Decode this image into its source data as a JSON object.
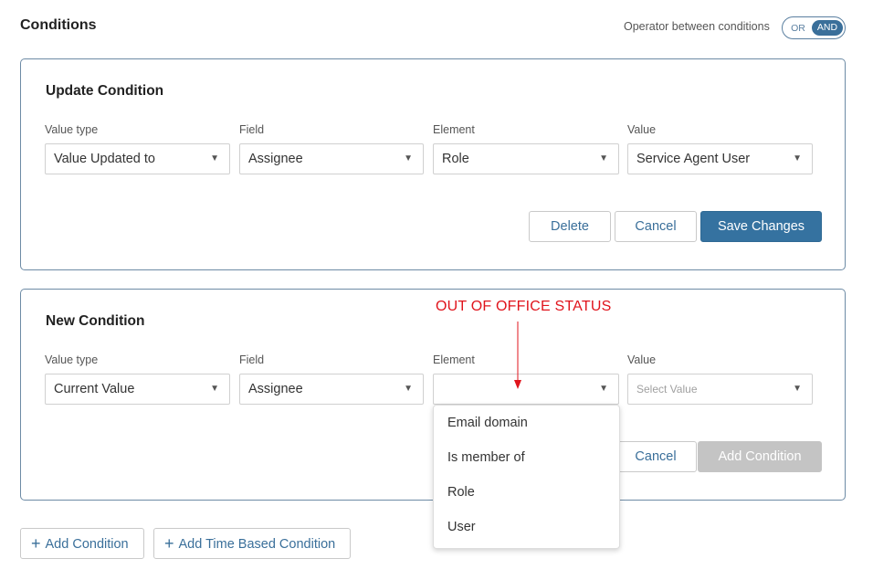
{
  "header": {
    "title": "Conditions",
    "operator_label": "Operator between conditions",
    "operator_or": "OR",
    "operator_and": "AND"
  },
  "update_condition": {
    "title": "Update Condition",
    "labels": {
      "value_type": "Value type",
      "field": "Field",
      "element": "Element",
      "value": "Value"
    },
    "values": {
      "value_type": "Value Updated to",
      "field": "Assignee",
      "element": "Role",
      "value": "Service Agent User"
    },
    "buttons": {
      "delete": "Delete",
      "cancel": "Cancel",
      "save": "Save Changes"
    }
  },
  "new_condition": {
    "title": "New Condition",
    "labels": {
      "value_type": "Value type",
      "field": "Field",
      "element": "Element",
      "value": "Value"
    },
    "values": {
      "value_type": "Current Value",
      "field": "Assignee",
      "element": ""
    },
    "value_placeholder": "Select Value",
    "buttons": {
      "cancel": "Cancel",
      "add": "Add Condition"
    }
  },
  "annotation": {
    "text": "OUT OF OFFICE STATUS",
    "color": "#e0141c"
  },
  "element_dropdown": {
    "options": [
      "Email domain",
      "Is member of",
      "Role",
      "User"
    ]
  },
  "bottom_actions": {
    "add_condition": "Add Condition",
    "add_time_based": "Add Time Based Condition"
  },
  "icons": {
    "caret": "caret-down-icon",
    "plus": "plus-icon"
  },
  "colors": {
    "primary": "#3572a0",
    "border": "#6d8ba5",
    "disabled": "#c4c4c4"
  }
}
